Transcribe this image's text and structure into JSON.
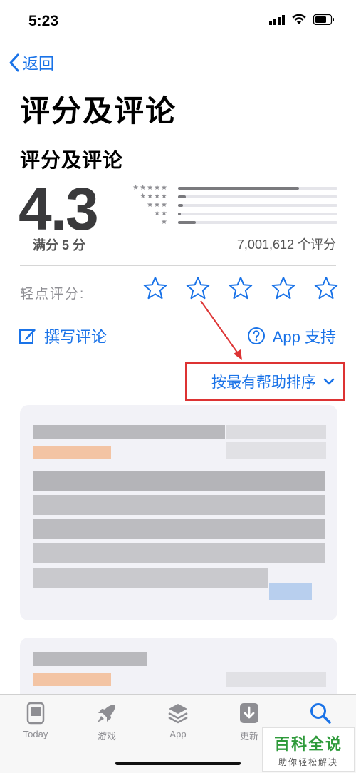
{
  "status_bar": {
    "time": "5:23"
  },
  "nav": {
    "back_label": "返回"
  },
  "page": {
    "title": "评分及评论"
  },
  "ratings": {
    "section_title": "评分及评论",
    "score": "4.3",
    "out_of": "满分 5 分",
    "count": "7,001,612 个评分",
    "distribution": [
      {
        "stars": 5,
        "fraction": 0.76
      },
      {
        "stars": 4,
        "fraction": 0.05
      },
      {
        "stars": 3,
        "fraction": 0.03
      },
      {
        "stars": 2,
        "fraction": 0.02
      },
      {
        "stars": 1,
        "fraction": 0.11
      }
    ]
  },
  "tap_to_rate": {
    "label": "轻点评分:"
  },
  "actions": {
    "write_review": "撰写评论",
    "app_support": "App 支持"
  },
  "sort": {
    "label": "按最有帮助排序"
  },
  "tab_bar": {
    "tabs": [
      {
        "label": "Today",
        "icon": "today-icon",
        "active": false
      },
      {
        "label": "游戏",
        "icon": "rocket-icon",
        "active": false
      },
      {
        "label": "App",
        "icon": "apps-stack-icon",
        "active": false
      },
      {
        "label": "更新",
        "icon": "download-icon",
        "active": false
      },
      {
        "label": "",
        "icon": "search-icon",
        "active": true
      }
    ]
  },
  "watermark": {
    "title": "百科全说",
    "subtitle": "助你轻松解决"
  },
  "colors": {
    "accent": "#1a73e8",
    "annotation": "#dd3333"
  }
}
